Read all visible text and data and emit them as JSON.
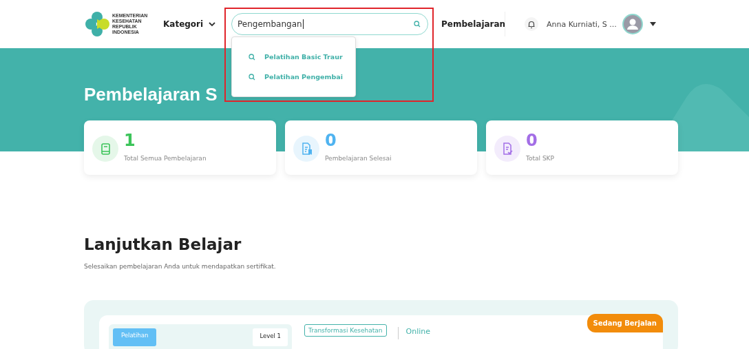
{
  "header": {
    "logo_text": [
      "KEMENTERIAN",
      "KESEHATAN",
      "REPUBLIK",
      "INDONESIA"
    ],
    "category_menu": "Kategori",
    "search": {
      "value": "Pengembangan"
    },
    "nav_link": "Pembelajaran",
    "user_name": "Anna Kurniati, S ..."
  },
  "search_suggestions": [
    "Pelatihan Basic Traur",
    "Pelatihan Pengembai"
  ],
  "hero": {
    "title": "Pembelajaran S"
  },
  "stats": [
    {
      "kind": "book",
      "value": "1",
      "label": "Total Semua Pembelajaran",
      "color": "#3cc45a"
    },
    {
      "kind": "document",
      "value": "0",
      "label": "Pembelajaran Selesai",
      "color": "#4fb3f0"
    },
    {
      "kind": "certificate",
      "value": "0",
      "label": "Total SKP",
      "color": "#a36ee6"
    }
  ],
  "continue": {
    "title": "Lanjutkan Belajar",
    "subtitle": "Selesaikan pembelajaran Anda untuk mendapatkan sertifikat."
  },
  "course_card": {
    "type_tag": "Pelatihan",
    "level": "Level 1",
    "topic": "Transformasi Kesehatan",
    "mode": "Online",
    "status": "Sedang Berjalan"
  }
}
